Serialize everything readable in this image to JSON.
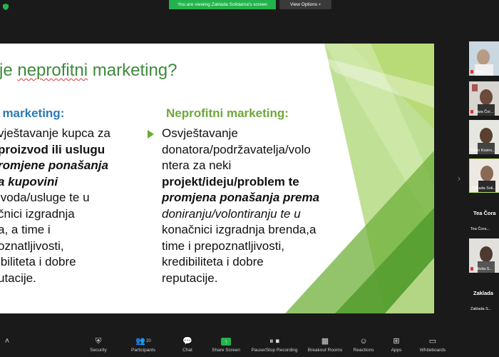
{
  "banner": {
    "text": "You are viewing Zaklada Solidarna's screen",
    "view_options": "View Options"
  },
  "slide": {
    "title_prefix": "je ",
    "title_word": "neprofitni",
    "title_suffix": " marketing?",
    "left_heading": "i marketing:",
    "right_heading": "Neprofitni marketing:",
    "left_lines": [
      "vještavanje kupca za",
      "proizvod ili uslugu",
      "romjene ponašanja",
      "a kupovini",
      "ivoda/usluge te u",
      "čnici izgradnja",
      "a, a time i",
      "oznatljivosti,",
      "ibiliteta i dobre",
      "utacije."
    ],
    "right_lines": [
      "Osvještavanje",
      "donatora/podržavatelja/volo",
      "ntera za neki",
      "projekt/ideju/problem te",
      "promjena ponašanja prema",
      "doniranju/volontiranju te u",
      "konačnici izgradnja brenda,a",
      "time i  prepoznatljivosti,",
      "kredibiliteta i dobre",
      "reputacije."
    ]
  },
  "participants": [
    {
      "name": "Ianja i l..."
    },
    {
      "name": "Sara Čor..."
    },
    {
      "name": "Milan Kosiro..."
    },
    {
      "name": "Zaklada Soli..."
    },
    {
      "big": "Tea  Čora",
      "name": "Tea Čora..."
    },
    {
      "name": "Nikola S..."
    },
    {
      "big": "Zaklada",
      "name": "Zaklada S..."
    }
  ],
  "toolbar": {
    "security": "Security",
    "participants": "Participants",
    "participants_count": "20",
    "chat": "Chat",
    "share_screen": "Share Screen",
    "pause_recording": "Pause/Stop Recording",
    "breakout_rooms": "Breakout Rooms",
    "reactions": "Reactions",
    "apps": "Apps",
    "whiteboards": "Whiteboards"
  },
  "colors": {
    "banner_green": "#23b34c",
    "title_green": "#3d8a3c",
    "left_heading_blue": "#2a7ab8",
    "right_heading_green": "#6ea83a"
  }
}
